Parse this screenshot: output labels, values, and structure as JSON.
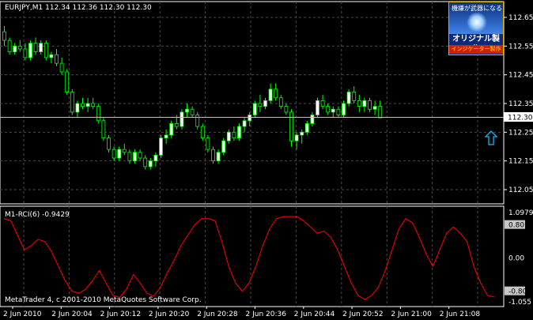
{
  "chart": {
    "header": "EURJPY,M1  112.34 112.36 112.30 112.30",
    "price_ticks": [
      "112.65",
      "112.55",
      "112.45",
      "112.35",
      "112.25",
      "112.15",
      "112.05"
    ],
    "current_price": "112.30",
    "copyright": "MetaTrader 4, c 2001-2010 MetaQuotes Software Corp."
  },
  "indicator": {
    "title": "M1-RCI(6) -0.9429",
    "ticks": [
      "1.0979",
      "0.80",
      "0.00",
      "-0.80",
      "-1.055"
    ]
  },
  "time_axis": {
    "labels": [
      "2 Jun 2010",
      "2 Jun 20:04",
      "2 Jun 20:12",
      "2 Jun 20:20",
      "2 Jun 20:28",
      "2 Jun 20:36",
      "2 Jun 20:44",
      "2 Jun 20:52",
      "2 Jun 21:00",
      "2 Jun 21:08"
    ]
  },
  "badge": {
    "top_text": "機嫌が武器になる",
    "main_text": "オリジナル製作",
    "sub_text": "インジケーター製作"
  },
  "colors": {
    "background": "#000000",
    "grid": "#4a4a4a",
    "bull_candle": "#ffffff",
    "bear_candle": "#000000",
    "candle_outline": "#00ff00",
    "rci_line": "#ff0000",
    "arrow": "#00bfff"
  },
  "chart_data": {
    "type": "candlestick",
    "symbol": "EURJPY",
    "timeframe": "M1",
    "y_range": [
      112.0,
      112.7
    ],
    "candles": [
      [
        112.6,
        112.62,
        112.55,
        112.57
      ],
      [
        112.57,
        112.58,
        112.52,
        112.53
      ],
      [
        112.53,
        112.56,
        112.52,
        112.55
      ],
      [
        112.55,
        112.57,
        112.53,
        112.54
      ],
      [
        112.54,
        112.56,
        112.5,
        112.51
      ],
      [
        112.51,
        112.57,
        112.5,
        112.56
      ],
      [
        112.56,
        112.58,
        112.52,
        112.53
      ],
      [
        112.53,
        112.57,
        112.52,
        112.56
      ],
      [
        112.56,
        112.57,
        112.5,
        112.51
      ],
      [
        112.51,
        112.53,
        112.49,
        112.52
      ],
      [
        112.52,
        112.54,
        112.48,
        112.49
      ],
      [
        112.49,
        112.51,
        112.45,
        112.46
      ],
      [
        112.46,
        112.47,
        112.38,
        112.39
      ],
      [
        112.39,
        112.4,
        112.31,
        112.32
      ],
      [
        112.32,
        112.36,
        112.3,
        112.35
      ],
      [
        112.35,
        112.37,
        112.33,
        112.34
      ],
      [
        112.34,
        112.37,
        112.32,
        112.35
      ],
      [
        112.35,
        112.37,
        112.33,
        112.34
      ],
      [
        112.34,
        112.35,
        112.28,
        112.29
      ],
      [
        112.29,
        112.3,
        112.22,
        112.23
      ],
      [
        112.23,
        112.24,
        112.18,
        112.19
      ],
      [
        112.19,
        112.2,
        112.15,
        112.16
      ],
      [
        112.16,
        112.2,
        112.15,
        112.19
      ],
      [
        112.19,
        112.21,
        112.17,
        112.18
      ],
      [
        112.18,
        112.19,
        112.14,
        112.15
      ],
      [
        112.15,
        112.19,
        112.14,
        112.18
      ],
      [
        112.18,
        112.19,
        112.15,
        112.16
      ],
      [
        112.16,
        112.17,
        112.12,
        112.13
      ],
      [
        112.13,
        112.16,
        112.12,
        112.15
      ],
      [
        112.15,
        112.18,
        112.13,
        112.17
      ],
      [
        112.17,
        112.24,
        112.16,
        112.23
      ],
      [
        112.23,
        112.26,
        112.21,
        112.24
      ],
      [
        112.24,
        112.29,
        112.23,
        112.28
      ],
      [
        112.28,
        112.31,
        112.26,
        112.27
      ],
      [
        112.27,
        112.33,
        112.26,
        112.32
      ],
      [
        112.32,
        112.35,
        112.3,
        112.33
      ],
      [
        112.33,
        112.34,
        112.3,
        112.31
      ],
      [
        112.31,
        112.32,
        112.26,
        112.27
      ],
      [
        112.27,
        112.28,
        112.22,
        112.23
      ],
      [
        112.23,
        112.24,
        112.18,
        112.19
      ],
      [
        112.19,
        112.2,
        112.14,
        112.15
      ],
      [
        112.15,
        112.19,
        112.14,
        112.18
      ],
      [
        112.18,
        112.23,
        112.17,
        112.22
      ],
      [
        112.22,
        112.26,
        112.21,
        112.25
      ],
      [
        112.25,
        112.27,
        112.22,
        112.23
      ],
      [
        112.23,
        112.28,
        112.22,
        112.27
      ],
      [
        112.27,
        112.3,
        112.25,
        112.29
      ],
      [
        112.29,
        112.32,
        112.27,
        112.31
      ],
      [
        112.31,
        112.36,
        112.3,
        112.35
      ],
      [
        112.35,
        112.38,
        112.32,
        112.34
      ],
      [
        112.34,
        112.37,
        112.33,
        112.36
      ],
      [
        112.36,
        112.42,
        112.35,
        112.4
      ],
      [
        112.4,
        112.42,
        112.36,
        112.37
      ],
      [
        112.37,
        112.38,
        112.33,
        112.34
      ],
      [
        112.34,
        112.35,
        112.31,
        112.32
      ],
      [
        112.32,
        112.33,
        112.2,
        112.22
      ],
      [
        112.22,
        112.25,
        112.19,
        112.24
      ],
      [
        112.24,
        112.26,
        112.21,
        112.25
      ],
      [
        112.25,
        112.29,
        112.24,
        112.28
      ],
      [
        112.28,
        112.32,
        112.27,
        112.31
      ],
      [
        112.31,
        112.37,
        112.3,
        112.36
      ],
      [
        112.36,
        112.38,
        112.33,
        112.34
      ],
      [
        112.34,
        112.35,
        112.31,
        112.32
      ],
      [
        112.32,
        112.34,
        112.3,
        112.33
      ],
      [
        112.33,
        112.34,
        112.3,
        112.31
      ],
      [
        112.31,
        112.36,
        112.3,
        112.35
      ],
      [
        112.35,
        112.4,
        112.34,
        112.39
      ],
      [
        112.39,
        112.41,
        112.35,
        112.36
      ],
      [
        112.36,
        112.38,
        112.32,
        112.34
      ],
      [
        112.34,
        112.37,
        112.32,
        112.36
      ],
      [
        112.36,
        112.37,
        112.32,
        112.33
      ],
      [
        112.33,
        112.36,
        112.31,
        112.34
      ],
      [
        112.34,
        112.36,
        112.3,
        112.3
      ]
    ],
    "rci": [
      0.95,
      0.9,
      0.55,
      0.2,
      0.3,
      0.45,
      0.4,
      0.15,
      -0.2,
      -0.55,
      -0.8,
      -0.85,
      -0.75,
      -0.55,
      -0.3,
      -0.6,
      -0.9,
      -0.95,
      -0.75,
      -0.4,
      -0.6,
      -0.85,
      -0.92,
      -0.7,
      -0.35,
      -0.05,
      0.3,
      0.55,
      0.8,
      0.95,
      0.95,
      0.9,
      0.4,
      -0.2,
      -0.6,
      -0.8,
      -0.6,
      -0.2,
      0.3,
      0.7,
      0.95,
      1.0,
      1.0,
      1.0,
      0.9,
      0.75,
      0.6,
      0.65,
      0.5,
      0.2,
      -0.2,
      -0.6,
      -0.9,
      -1.0,
      -0.9,
      -0.7,
      -0.3,
      0.2,
      0.7,
      0.95,
      0.85,
      0.5,
      0.1,
      -0.2,
      0.2,
      0.6,
      0.75,
      0.6,
      0.4,
      -0.2,
      -0.6,
      -0.9,
      -0.94
    ]
  }
}
